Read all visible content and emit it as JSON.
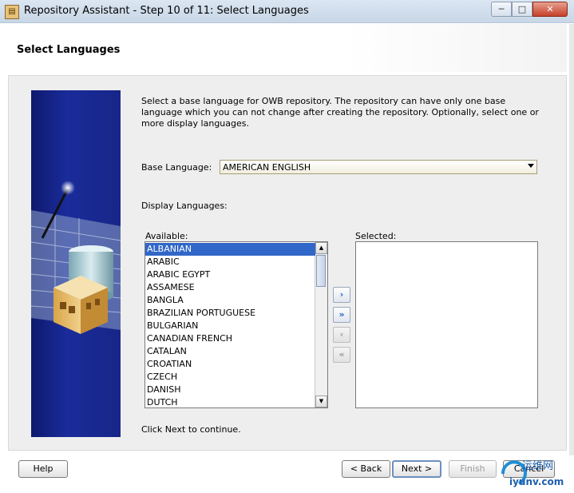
{
  "window": {
    "title": "Repository Assistant - Step 10 of 11: Select Languages",
    "buttons": {
      "minimize": "─",
      "maximize": "□",
      "close": "✕"
    }
  },
  "header": {
    "heading": "Select Languages"
  },
  "description": "Select a base language for OWB repository. The repository can have only one base language which you can not change after creating the repository.  Optionally, select one or more display languages.",
  "base_language": {
    "label": "Base Language:",
    "value": "AMERICAN ENGLISH"
  },
  "display_languages": {
    "label": "Display Languages:",
    "available_label": "Available:",
    "selected_label": "Selected:",
    "available_items": [
      "ALBANIAN",
      "ARABIC",
      "ARABIC EGYPT",
      "ASSAMESE",
      "BANGLA",
      "BRAZILIAN PORTUGUESE",
      "BULGARIAN",
      "CANADIAN FRENCH",
      "CATALAN",
      "CROATIAN",
      "CZECH",
      "DANISH",
      "DUTCH"
    ],
    "selected_item": "ALBANIAN",
    "selected_items": [],
    "move_buttons": {
      "add": "›",
      "add_all": "»",
      "remove": "‹",
      "remove_all": "«"
    }
  },
  "note": "Click Next to continue.",
  "footer": {
    "help": "Help",
    "back": "< Back",
    "next": "Next >",
    "finish": "Finish",
    "cancel": "Cancel"
  },
  "watermark": {
    "text": "运维网",
    "url_text": "iyunv.com"
  },
  "colors": {
    "selection": "#3167c8",
    "graphic_bg": "#1a2b9a",
    "accent_arrow": "#1f64c4"
  }
}
